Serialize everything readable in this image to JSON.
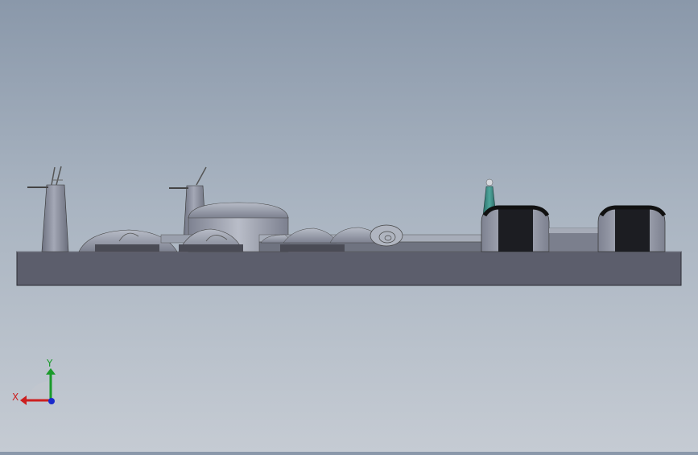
{
  "viewport": {
    "background_top": "#8a98aa",
    "background_bottom": "#c5cbd3",
    "model_base_color": "#5c5e6c"
  },
  "triad": {
    "x_label": "X",
    "y_label": "Y",
    "x_color": "#cc1f1f",
    "y_color": "#1a9a2a",
    "z_color": "#1a2acc"
  }
}
